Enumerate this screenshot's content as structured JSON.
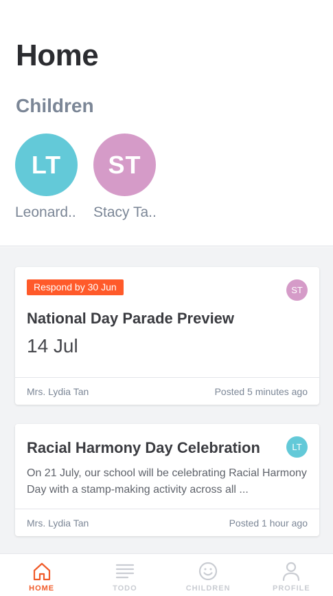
{
  "page": {
    "title": "Home"
  },
  "children_section": {
    "title": "Children",
    "children": [
      {
        "initials": "LT",
        "name": "Leonard..",
        "color": "#63c9d8"
      },
      {
        "initials": "ST",
        "name": "Stacy Ta..",
        "color": "#d59bc8"
      }
    ]
  },
  "cards": [
    {
      "badge": "Respond by 30 Jun",
      "avatar": "ST",
      "avatar_color": "#d59bc8",
      "title": "National Day Parade Preview",
      "date": "14 Jul",
      "author": "Mrs. Lydia Tan",
      "posted": "Posted 5 minutes ago"
    },
    {
      "avatar": "LT",
      "avatar_color": "#63c9d8",
      "title": "Racial Harmony Day Celebration",
      "body": "On 21 July, our school will be celebrating Racial Harmony Day with a stamp-making activity across all ...",
      "author": "Mrs. Lydia Tan",
      "posted": "Posted 1 hour ago"
    }
  ],
  "tabbar": {
    "tabs": [
      {
        "label": "HOME",
        "icon": "home-icon",
        "active": true
      },
      {
        "label": "TODO",
        "icon": "list-icon",
        "active": false
      },
      {
        "label": "CHILDREN",
        "icon": "smiley-icon",
        "active": false
      },
      {
        "label": "PROFILE",
        "icon": "user-icon",
        "active": false
      }
    ]
  },
  "colors": {
    "accent": "#f05a28",
    "badge": "#ff5a2a",
    "muted": "#7b8696"
  }
}
